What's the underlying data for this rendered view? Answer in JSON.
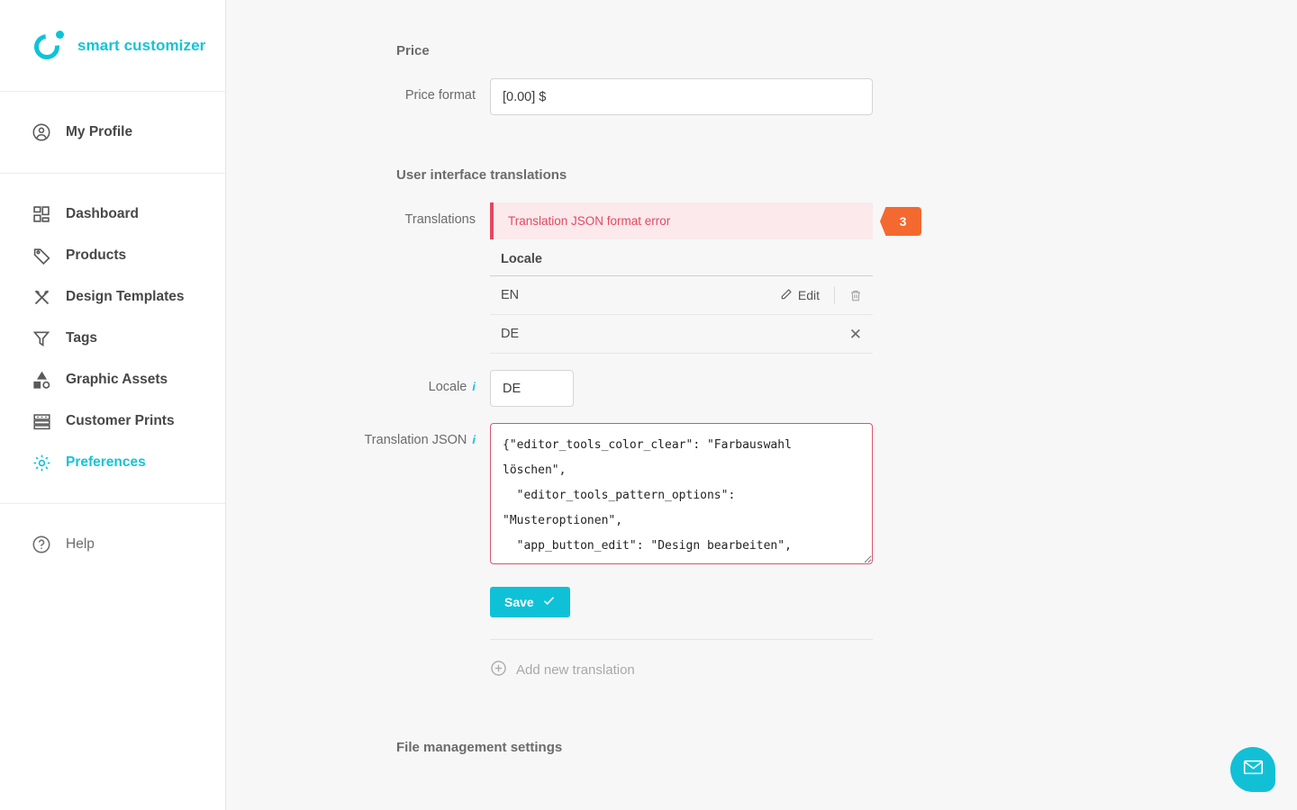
{
  "brand": {
    "name": "smart customizer",
    "logo_icon": "circle-dot-logo-icon",
    "accent_color": "#16c3d6"
  },
  "sidebar": {
    "profile": {
      "label": "My Profile",
      "icon": "user-circle-icon"
    },
    "items": [
      {
        "label": "Dashboard",
        "icon": "grid-dashboard-icon"
      },
      {
        "label": "Products",
        "icon": "tag-icon"
      },
      {
        "label": "Design Templates",
        "icon": "pencil-ruler-icon"
      },
      {
        "label": "Tags",
        "icon": "funnel-icon"
      },
      {
        "label": "Graphic Assets",
        "icon": "shapes-icon"
      },
      {
        "label": "Customer Prints",
        "icon": "print-rows-icon"
      },
      {
        "label": "Preferences",
        "icon": "gear-icon",
        "active": true
      }
    ],
    "help": {
      "label": "Help",
      "icon": "question-circle-icon"
    }
  },
  "main": {
    "price_section": {
      "title": "Price",
      "price_format": {
        "label": "Price format",
        "value": "[0.00] $"
      }
    },
    "translations_section": {
      "title": "User interface translations",
      "translations_label": "Translations",
      "error_message": "Translation JSON format error",
      "error_badge_count": "3",
      "error_color": "#e8475e",
      "badge_color": "#f4692f",
      "table": {
        "header": "Locale",
        "rows": [
          {
            "code": "EN",
            "edit_label": "Edit",
            "edit_icon": "pencil-icon",
            "delete_icon": "trash-icon"
          },
          {
            "code": "DE",
            "close_icon": "close-icon"
          }
        ]
      },
      "locale_field": {
        "label": "Locale",
        "value": "DE",
        "info_icon": "info-icon"
      },
      "json_field": {
        "label": "Translation JSON",
        "info_icon": "info-icon",
        "value": "{\"editor_tools_color_clear\": \"Farbauswahl löschen\",\n  \"editor_tools_pattern_options\": \"Musteroptionen\",\n  \"app_button_edit\": \"Design bearbeiten\",\n  \"app_button_customize\": \"Produkt anpassen\""
      },
      "save_label": "Save",
      "save_icon": "check-icon",
      "add_new_label": "Add new translation",
      "add_new_icon": "plus-circle-icon"
    },
    "file_section": {
      "title": "File management settings"
    }
  },
  "chat_widget": {
    "icon": "envelope-icon",
    "color": "#12c0d6"
  }
}
